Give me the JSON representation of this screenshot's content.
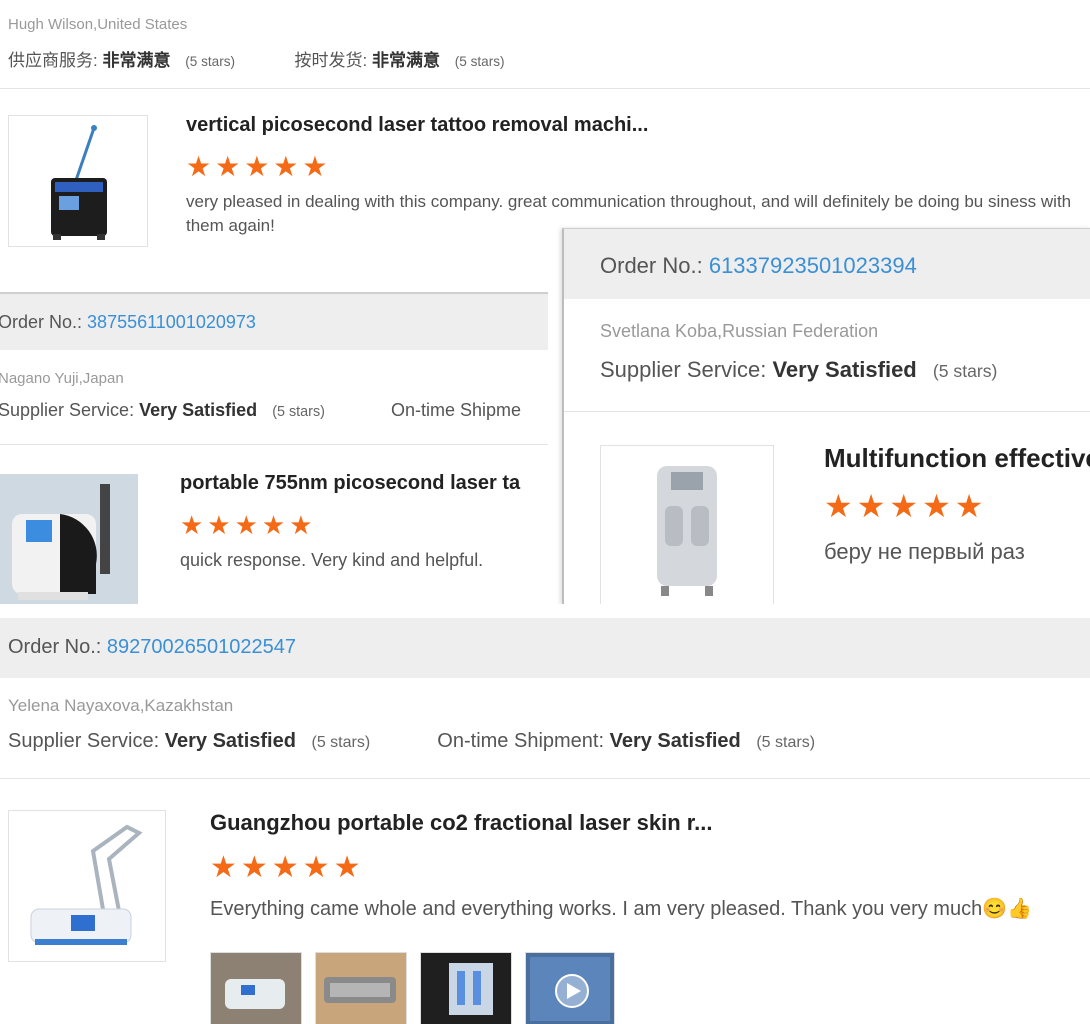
{
  "colors": {
    "accent_blue": "#3a8fd6",
    "star_orange": "#f56a16",
    "bar_gray": "#eeeeee"
  },
  "panel_a": {
    "reviewer": "Hugh Wilson,United States",
    "service_label": "供应商服务:",
    "service_value": "非常满意",
    "service_stars": "(5 stars)",
    "ship_label": "按时发货:",
    "ship_value": "非常满意",
    "ship_stars": "(5 stars)",
    "product_title": "vertical picosecond laser tattoo removal machi...",
    "stars": "★★★★★",
    "rating": 5,
    "comment": "very pleased in dealing with this company. great communication throughout, and will definitely be doing bu siness with them again!"
  },
  "panel_b": {
    "order_label": "Order No.:",
    "order_number": "38755611001020973",
    "reviewer": "Nagano Yuji,Japan",
    "service_label": "Supplier Service:",
    "service_value": "Very Satisfied",
    "service_stars": "(5 stars)",
    "ship_label": "On-time Shipme",
    "product_title": "portable 755nm picosecond laser ta",
    "stars": "★★★★★",
    "rating": 5,
    "comment": "quick response.  Very kind and helpful."
  },
  "panel_c": {
    "order_label": "Order No.:",
    "order_number": "61337923501023394",
    "reviewer": "Svetlana Koba,Russian Federation",
    "service_label": "Supplier Service:",
    "service_value": "Very Satisfied",
    "service_stars": "(5 stars)",
    "product_title": "Multifunction effective",
    "stars": "★★★★★",
    "rating": 5,
    "comment": "беру не первый раз"
  },
  "panel_d": {
    "order_label": "Order No.:",
    "order_number": "89270026501022547",
    "reviewer": "Yelena Nayaxova,Kazakhstan",
    "service_label": "Supplier Service:",
    "service_value": "Very Satisfied",
    "service_stars": "(5 stars)",
    "ship_label": "On-time Shipment:",
    "ship_value": "Very Satisfied",
    "ship_stars": "(5 stars)",
    "product_title": "Guangzhou portable co2 fractional laser skin r...",
    "stars": "★★★★★",
    "rating": 5,
    "comment": "Everything came whole and everything works.  I am very pleased.  Thank you very much😊👍"
  }
}
